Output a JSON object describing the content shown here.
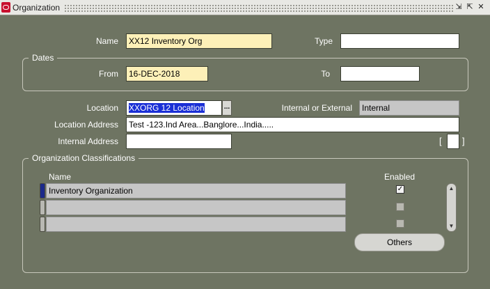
{
  "window": {
    "title": "Organization",
    "controls": {
      "minimize": "⇲",
      "maximize": "⇱",
      "close": "✕"
    }
  },
  "header": {
    "name_label": "Name",
    "name_value": "XX12 Inventory Org",
    "type_label": "Type",
    "type_value": ""
  },
  "dates": {
    "group_title": "Dates",
    "from_label": "From",
    "from_value": "16-DEC-2018",
    "to_label": "To",
    "to_value": ""
  },
  "location": {
    "location_label": "Location",
    "location_value": "XXORG 12 Location",
    "lov_button": "...",
    "internal_external_label": "Internal or External",
    "internal_external_value": "Internal",
    "location_address_label": "Location Address",
    "location_address_value": "Test -123.Ind Area...Banglore...India.....",
    "internal_address_label": "Internal Address",
    "internal_address_value": "",
    "bracket_open": "[",
    "bracket_close": "]",
    "bracket_value": ""
  },
  "classifications": {
    "group_title": "Organization Classifications",
    "name_header": "Name",
    "enabled_header": "Enabled",
    "rows": [
      {
        "name": "Inventory Organization",
        "enabled": true
      },
      {
        "name": "",
        "enabled": false
      },
      {
        "name": "",
        "enabled": false
      }
    ],
    "others_button": "Others"
  },
  "colors": {
    "background": "#6e7462",
    "required_field": "#fdf0b8",
    "selection": "#1a2fd6",
    "readonly_field": "#c6c6c6"
  }
}
